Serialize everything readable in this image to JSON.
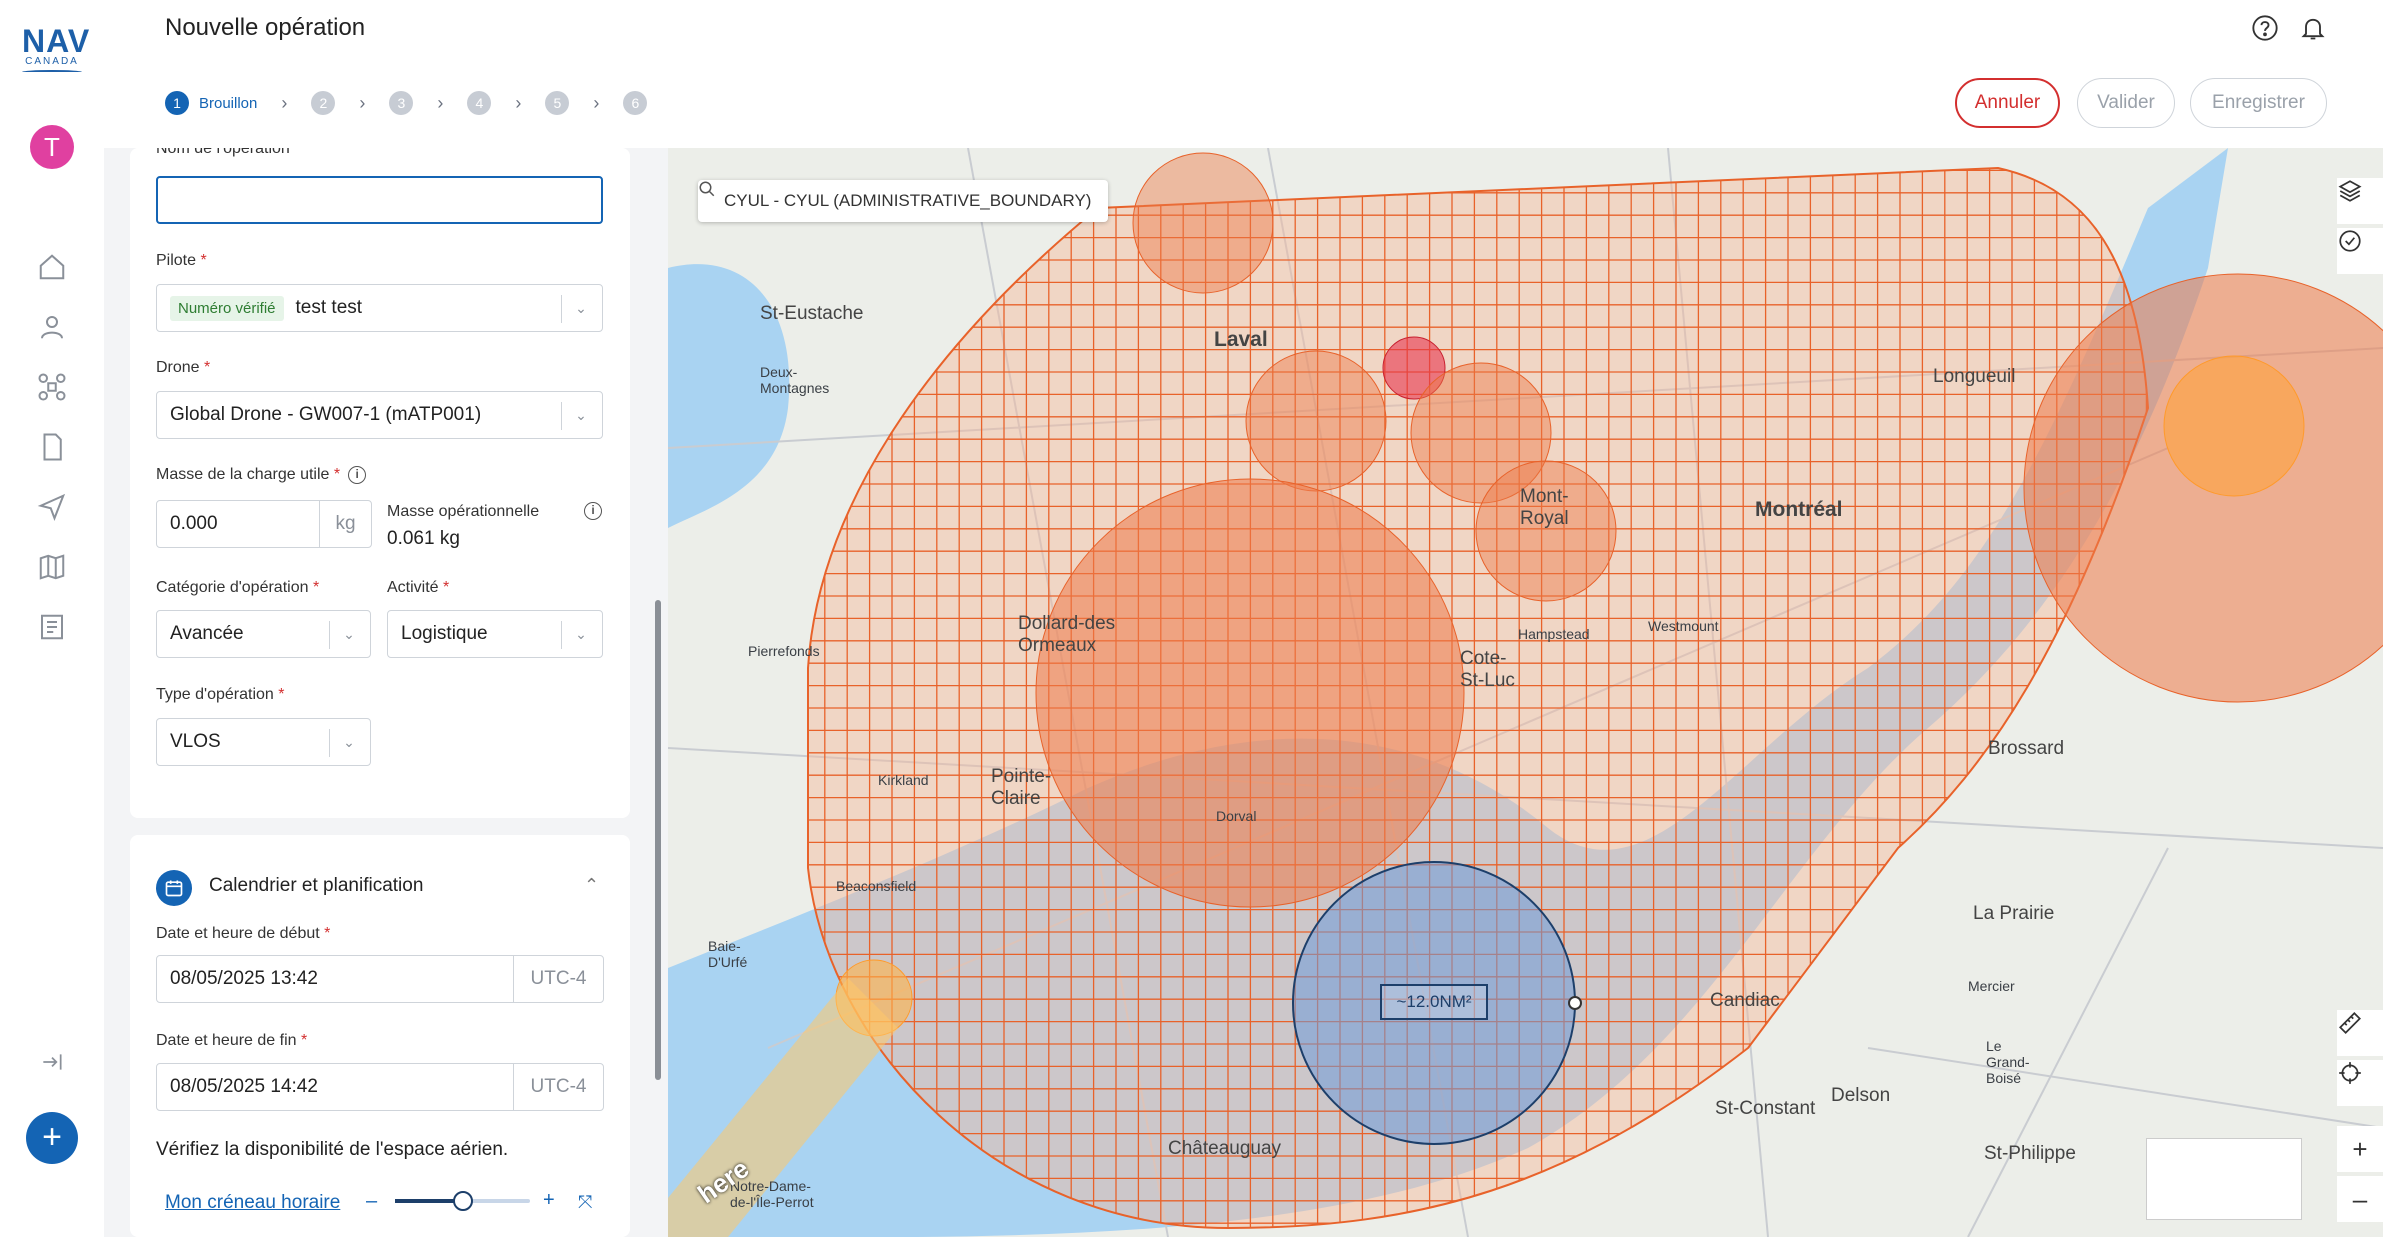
{
  "app": {
    "logo_text": "NAV",
    "logo_sub": "CANADA",
    "avatar_initial": "T",
    "title": "Nouvelle opération"
  },
  "stepper": {
    "steps": [
      {
        "num": "1",
        "label": "Brouillon"
      },
      {
        "num": "2",
        "label": ""
      },
      {
        "num": "3",
        "label": ""
      },
      {
        "num": "4",
        "label": ""
      },
      {
        "num": "5",
        "label": ""
      },
      {
        "num": "6",
        "label": ""
      }
    ]
  },
  "actions": {
    "cancel": "Annuler",
    "validate": "Valider",
    "save": "Enregistrer"
  },
  "form": {
    "op_name_label": "Nom de l'opération",
    "op_name_value": "",
    "pilot_label": "Pilote",
    "pilot_chip": "Numéro vérifié",
    "pilot_value": "test test",
    "drone_label": "Drone",
    "drone_value": "Global Drone - GW007-1 (mATP001)",
    "payload_label": "Masse de la charge utile",
    "payload_value": "0.000",
    "payload_unit": "kg",
    "op_mass_label": "Masse opérationnelle",
    "op_mass_value": "0.061 kg",
    "category_label": "Catégorie d'opération",
    "category_value": "Avancée",
    "activity_label": "Activité",
    "activity_value": "Logistique",
    "op_type_label": "Type d'opération",
    "op_type_value": "VLOS",
    "required_mark": "*"
  },
  "schedule": {
    "title": "Calendrier et planification",
    "start_label": "Date et heure de début",
    "start_value": "08/05/2025 13:42",
    "start_tz": "UTC-4",
    "end_label": "Date et heure de fin",
    "end_value": "08/05/2025 14:42",
    "end_tz": "UTC-4",
    "note": "Vérifiez la disponibilité de l'espace aérien.",
    "slot_link": "Mon créneau horaire",
    "slider_value": 0.5
  },
  "map": {
    "search_text": "CYUL - CYUL (ADMINISTRATIVE_BOUNDARY)",
    "area_text": "~12.0NM²",
    "provider": "here",
    "labels": {
      "laval": "Laval",
      "montreal": "Montréal",
      "longueuil": "Longueuil",
      "brossard": "Brossard",
      "st_eustache": "St-Eustache",
      "deux_montagnes": "Deux-Montagnes",
      "dollard": "Dollard-des Ormeaux",
      "pointe_claire": "Pointe-Claire",
      "dorval": "Dorval",
      "cote_st_luc": "Cote-St-Luc",
      "westmount": "Westmount",
      "mont_royal": "Mont-Royal",
      "kirkland": "Kirkland",
      "beaconsfield": "Beaconsfield",
      "baie_durfe": "Baie-D'Urfé",
      "chateauguay": "Châteauguay",
      "st_constant": "St-Constant",
      "candiac": "Candiac",
      "la_prairie": "La Prairie",
      "delson": "Delson",
      "st_philippe": "St-Philippe",
      "mercier": "Mercier",
      "hampstead": "Hampstead",
      "pierrefonds": "Pierrefonds",
      "ile_perrot": "Notre-Dame-de-l'Île-Perrot",
      "le_grand_boise": "Le Grand-Boisé"
    }
  },
  "colors": {
    "primary": "#1464b4",
    "danger": "#d32f2f",
    "grid": "#e8622a",
    "zone_fill": "#f7b99a",
    "circle_orange": "#ee7a48",
    "circle_red": "#e8344c",
    "op_circle": "#6f9bd8",
    "avatar": "#e040a0"
  }
}
